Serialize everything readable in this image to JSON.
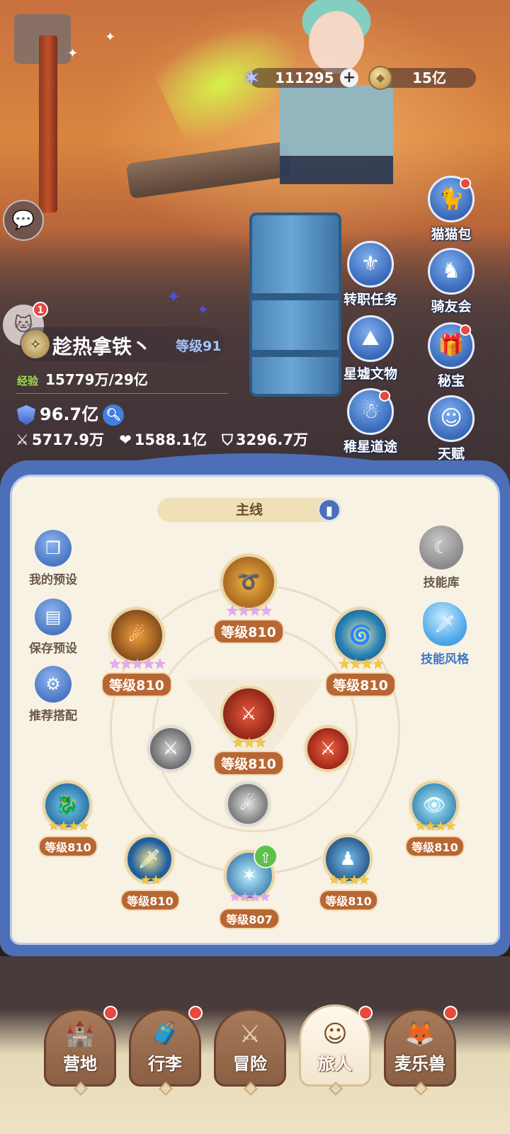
{
  "resources": {
    "gems": "111295",
    "coins": "15亿"
  },
  "left": {
    "chat_icon": "chat-bubbles-icon",
    "pet_badge": "1",
    "player_name": "趁热拿铁丶",
    "player_level": "等级91",
    "exp_label": "经验",
    "exp_value": "15779万/29亿",
    "power": "96.7亿",
    "attack": "5717.9万",
    "hp": "1588.1亿",
    "defense": "3296.7万"
  },
  "features": [
    {
      "label": "猫猫包",
      "icon": "cat-bag-icon"
    },
    {
      "label": "转职任务",
      "icon": "class-change-icon"
    },
    {
      "label": "骑友会",
      "icon": "horse-icon"
    },
    {
      "label": "星墟文物",
      "icon": "relic-icon"
    },
    {
      "label": "秘宝",
      "icon": "treasure-icon"
    },
    {
      "label": "稚星道途",
      "icon": "path-icon"
    },
    {
      "label": "天赋",
      "icon": "talent-head-icon"
    }
  ],
  "panel": {
    "tab_label": "主线",
    "left_tools": [
      {
        "label": "我的预设"
      },
      {
        "label": "保存预设"
      },
      {
        "label": "推荐搭配"
      }
    ],
    "right_tools": [
      {
        "label": "技能库"
      },
      {
        "label": "技能风格"
      }
    ],
    "skills": [
      {
        "level": "等级810",
        "stars": "★★★★",
        "star_color": "purple",
        "color": "#c9841f"
      },
      {
        "level": "等级810",
        "stars": "★★★★★",
        "star_color": "purple",
        "color": "#d2761c"
      },
      {
        "level": "等级810",
        "stars": "★★★★",
        "star_color": "gold",
        "color": "#2a84b9"
      },
      {
        "level": "等级810",
        "stars": "★★★",
        "star_color": "gold",
        "color": "#a82b24"
      },
      {
        "level": "等级810",
        "stars": "★★★★",
        "star_color": "gold",
        "color": "#2d7fbf"
      },
      {
        "level": "等级810",
        "stars": "★★★★",
        "star_color": "gold",
        "color": "#2a8fb9"
      },
      {
        "level": "等级810",
        "stars": "★★",
        "star_color": "gold",
        "color": "#3d8fcf"
      },
      {
        "level": "等级807",
        "stars": "★★★★",
        "star_color": "purple",
        "color": "#2877b6"
      },
      {
        "level": "等级810",
        "stars": "★★★★",
        "star_color": "gold",
        "color": "#1f5f9e"
      }
    ],
    "locked_skill_color": "#6d6d6d",
    "red_skill_color": "#b2241c"
  },
  "nav": [
    {
      "label": "营地",
      "icon": "castle-icon"
    },
    {
      "label": "行李",
      "icon": "luggage-icon"
    },
    {
      "label": "冒险",
      "icon": "crossed-swords-icon"
    },
    {
      "label": "旅人",
      "icon": "traveler-avatar-icon"
    },
    {
      "label": "麦乐兽",
      "icon": "fox-pet-icon"
    }
  ]
}
